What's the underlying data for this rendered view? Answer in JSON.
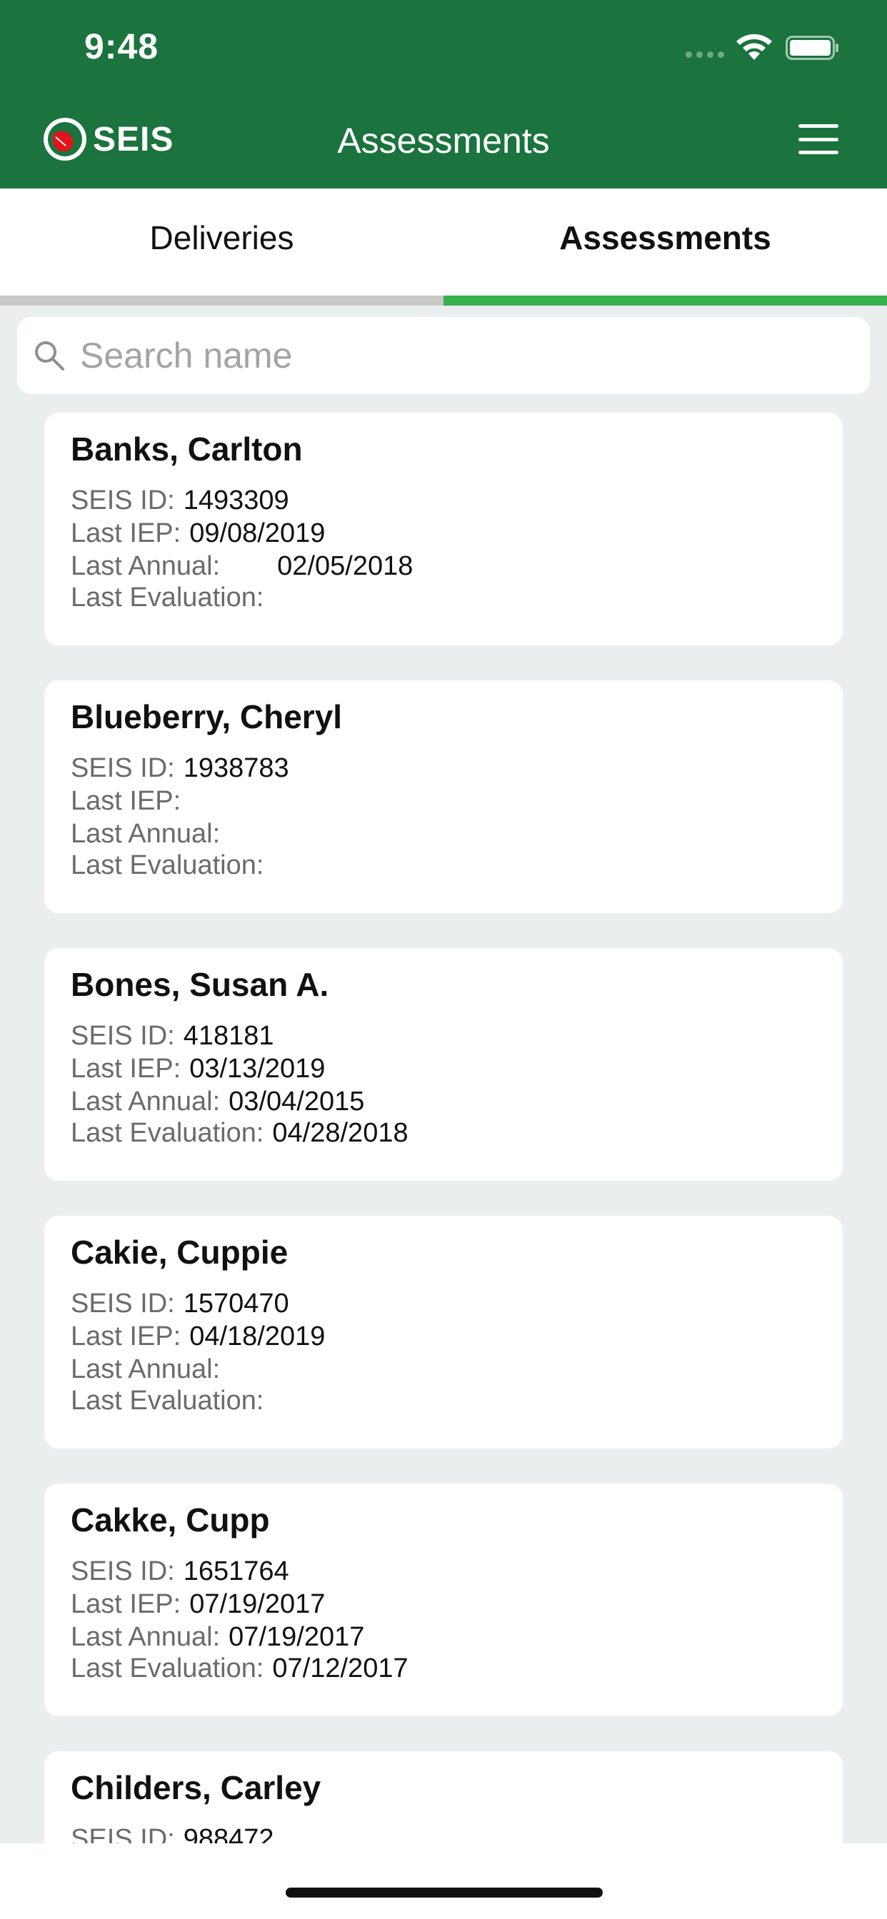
{
  "status_bar": {
    "time": "9:48"
  },
  "header": {
    "logo_text": "SEIS",
    "title": "Assessments"
  },
  "tabs": [
    {
      "label": "Deliveries",
      "active": false
    },
    {
      "label": "Assessments",
      "active": true
    }
  ],
  "search": {
    "placeholder": "Search name",
    "value": ""
  },
  "labels": {
    "seis_id": "SEIS ID:",
    "last_iep": "Last IEP:",
    "last_annual": "Last Annual:",
    "last_evaluation": "Last Evaluation:"
  },
  "students": [
    {
      "name": "Banks, Carlton",
      "seis_id": "1493309",
      "last_iep": "09/08/2019",
      "last_annual": "02/05/2018",
      "last_evaluation": ""
    },
    {
      "name": "Blueberry, Cheryl",
      "seis_id": "1938783",
      "last_iep": "",
      "last_annual": "",
      "last_evaluation": ""
    },
    {
      "name": "Bones, Susan A.",
      "seis_id": "418181",
      "last_iep": "03/13/2019",
      "last_annual": "03/04/2015",
      "last_evaluation": "04/28/2018"
    },
    {
      "name": "Cakie, Cuppie",
      "seis_id": "1570470",
      "last_iep": "04/18/2019",
      "last_annual": "",
      "last_evaluation": ""
    },
    {
      "name": "Cakke, Cupp",
      "seis_id": "1651764",
      "last_iep": "07/19/2017",
      "last_annual": "07/19/2017",
      "last_evaluation": "07/12/2017"
    },
    {
      "name": "Childers, Carley",
      "seis_id": "988472",
      "last_iep": "",
      "last_annual": "",
      "last_evaluation": ""
    }
  ],
  "colors": {
    "brand_green": "#1b733d",
    "tab_active": "#39b04e",
    "background": "#ebeeee"
  },
  "icons": [
    "wifi-icon",
    "battery-icon",
    "seis-logo-icon",
    "hamburger-menu-icon",
    "search-icon"
  ]
}
